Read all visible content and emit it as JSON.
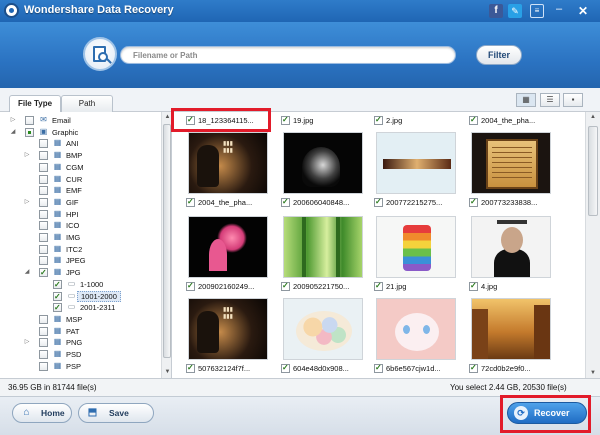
{
  "window": {
    "title": "Wondershare Data Recovery"
  },
  "search": {
    "placeholder": "Filename or Path",
    "filter_label": "Filter"
  },
  "tabs": [
    "File Type",
    "Path"
  ],
  "tree": [
    {
      "label": "Email",
      "indent": 1,
      "arrow": "▷",
      "check": "off",
      "icon": "✉"
    },
    {
      "label": "Graphic",
      "indent": 1,
      "arrow": "◢",
      "check": "part",
      "icon": "▣"
    },
    {
      "label": "ANI",
      "indent": 2,
      "arrow": "",
      "check": "off",
      "icon": "▦"
    },
    {
      "label": "BMP",
      "indent": 2,
      "arrow": "▷",
      "check": "off",
      "icon": "▦"
    },
    {
      "label": "CGM",
      "indent": 2,
      "arrow": "",
      "check": "off",
      "icon": "▦"
    },
    {
      "label": "CUR",
      "indent": 2,
      "arrow": "",
      "check": "off",
      "icon": "▦"
    },
    {
      "label": "EMF",
      "indent": 2,
      "arrow": "",
      "check": "off",
      "icon": "▦"
    },
    {
      "label": "GIF",
      "indent": 2,
      "arrow": "▷",
      "check": "off",
      "icon": "▦"
    },
    {
      "label": "HPI",
      "indent": 2,
      "arrow": "",
      "check": "off",
      "icon": "▦"
    },
    {
      "label": "ICO",
      "indent": 2,
      "arrow": "",
      "check": "off",
      "icon": "▦"
    },
    {
      "label": "IMG",
      "indent": 2,
      "arrow": "",
      "check": "off",
      "icon": "▦"
    },
    {
      "label": "ITC2",
      "indent": 2,
      "arrow": "",
      "check": "off",
      "icon": "▦"
    },
    {
      "label": "JPEG",
      "indent": 2,
      "arrow": "",
      "check": "off",
      "icon": "▦"
    },
    {
      "label": "JPG",
      "indent": 2,
      "arrow": "◢",
      "check": "on",
      "icon": "▦"
    },
    {
      "label": "1-1000",
      "indent": 3,
      "arrow": "",
      "check": "on",
      "icon": "▭"
    },
    {
      "label": "1001-2000",
      "indent": 3,
      "arrow": "",
      "check": "on",
      "icon": "▭",
      "selected": true
    },
    {
      "label": "2001-2311",
      "indent": 3,
      "arrow": "",
      "check": "on",
      "icon": "▭"
    },
    {
      "label": "MSP",
      "indent": 2,
      "arrow": "",
      "check": "off",
      "icon": "▦"
    },
    {
      "label": "PAT",
      "indent": 2,
      "arrow": "",
      "check": "off",
      "icon": "▦"
    },
    {
      "label": "PNG",
      "indent": 2,
      "arrow": "▷",
      "check": "off",
      "icon": "▦"
    },
    {
      "label": "PSD",
      "indent": 2,
      "arrow": "",
      "check": "off",
      "icon": "▦"
    },
    {
      "label": "PSP",
      "indent": 2,
      "arrow": "",
      "check": "off",
      "icon": "▦"
    }
  ],
  "thumbnails": {
    "top_labels": [
      "18_123364115...",
      "19.jpg",
      "2.jpg",
      "2004_the_pha..."
    ],
    "rows": [
      [
        {
          "label": "2004_the_pha...",
          "art": "poster",
          "bg": "#2a1e16"
        },
        {
          "label": "200606040848...",
          "art": "lady",
          "bg": "#0c0c0c"
        },
        {
          "label": "200772215275...",
          "art": "strip",
          "bg": "#d9e8ef"
        },
        {
          "label": "200773233838...",
          "art": "scroll",
          "bg": "#1b1410"
        }
      ],
      [
        {
          "label": "200902160249...",
          "art": "tree",
          "bg": "#060606"
        },
        {
          "label": "200905221750...",
          "art": "bamboo",
          "bg": "#4b8e2e"
        },
        {
          "label": "21.jpg",
          "art": "cake",
          "bg": "#f3f5f3"
        },
        {
          "label": "4.jpg",
          "art": "person",
          "bg": "#f1f1f1"
        }
      ],
      [
        {
          "label": "507632124f7f...",
          "art": "poster",
          "bg": "#2a1e16"
        },
        {
          "label": "604e48d0x908...",
          "art": "flowers",
          "bg": "#e7eef3"
        },
        {
          "label": "6b6e567cjw1d...",
          "art": "cat",
          "bg": "#f4c9c6"
        },
        {
          "label": "72cd0b2e9f0...",
          "art": "street",
          "bg": "#c98e3c"
        }
      ]
    ]
  },
  "status": {
    "left": "36.95 GB in 81744 file(s)",
    "right": "You select 2.44 GB, 20530 file(s)"
  },
  "buttons": {
    "home": "Home",
    "save": "Save",
    "recover": "Recover"
  },
  "colors": {
    "titlebar": "#1f66b4",
    "accent": "#2b73c2",
    "highlight": "#e21b2a",
    "recover": "#1f6cc4"
  }
}
